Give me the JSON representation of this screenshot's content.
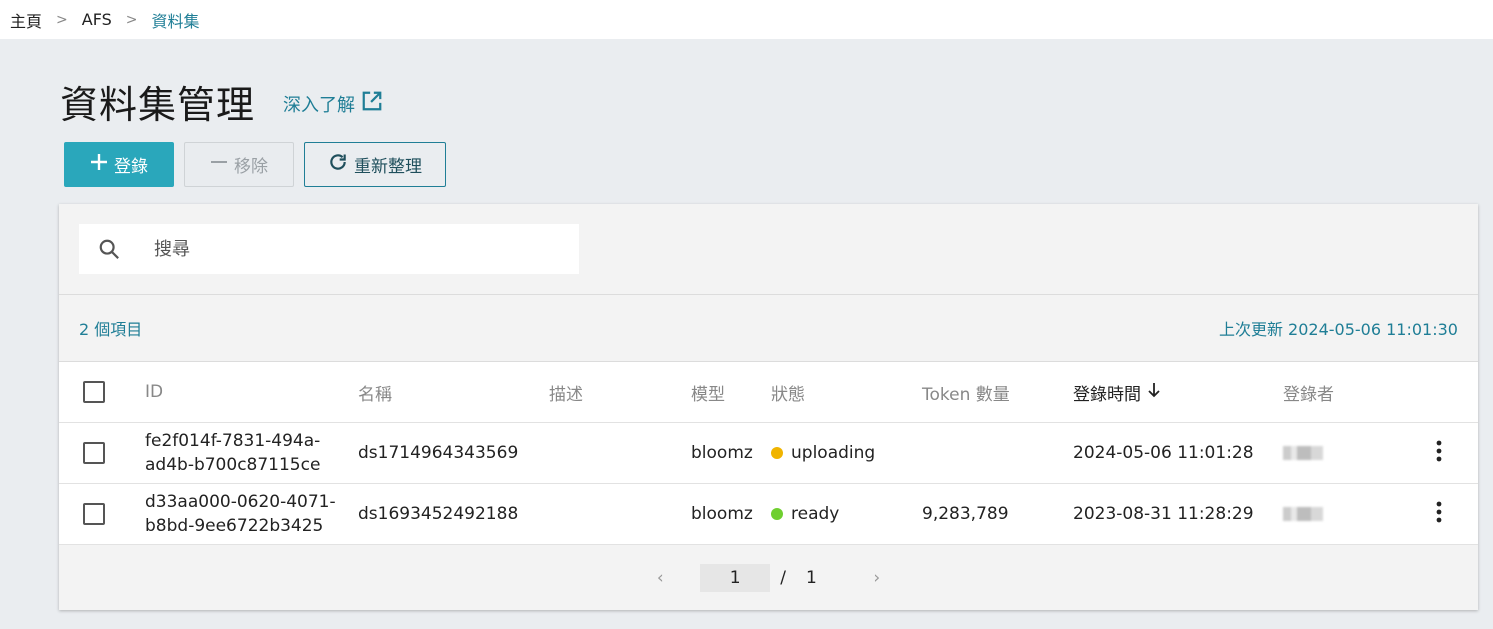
{
  "breadcrumb": {
    "home": "主頁",
    "afs": "AFS",
    "current": "資料集",
    "separator": ">"
  },
  "page": {
    "title": "資料集管理",
    "learn_more": "深入了解"
  },
  "toolbar": {
    "register": "登錄",
    "remove": "移除",
    "refresh": "重新整理"
  },
  "search": {
    "placeholder": "搜尋"
  },
  "summary": {
    "count": "2 個項目",
    "last_updated": "上次更新 2024-05-06 11:01:30"
  },
  "table": {
    "headers": {
      "id": "ID",
      "name": "名稱",
      "description": "描述",
      "model": "模型",
      "status": "狀態",
      "token_count": "Token 數量",
      "registered_time": "登錄時間",
      "registered_by": "登錄者"
    },
    "rows": [
      {
        "id_line1": "fe2f014f-7831-494a-",
        "id_line2": "ad4b-b700c87115ce",
        "name": "ds1714964343569",
        "description": "",
        "model": "bloomz",
        "status": "uploading",
        "status_color": "#f0b400",
        "token_count": "",
        "registered_time": "2024-05-06 11:01:28"
      },
      {
        "id_line1": "d33aa000-0620-4071-",
        "id_line2": "b8bd-9ee6722b3425",
        "name": "ds1693452492188",
        "description": "",
        "model": "bloomz",
        "status": "ready",
        "status_color": "#6fcf2f",
        "token_count": "9,283,789",
        "registered_time": "2023-08-31 11:28:29"
      }
    ]
  },
  "pagination": {
    "current": "1",
    "separator": "/",
    "total": "1"
  },
  "colors": {
    "accent": "#1f7e96",
    "primary_button": "#2aa7bb"
  }
}
